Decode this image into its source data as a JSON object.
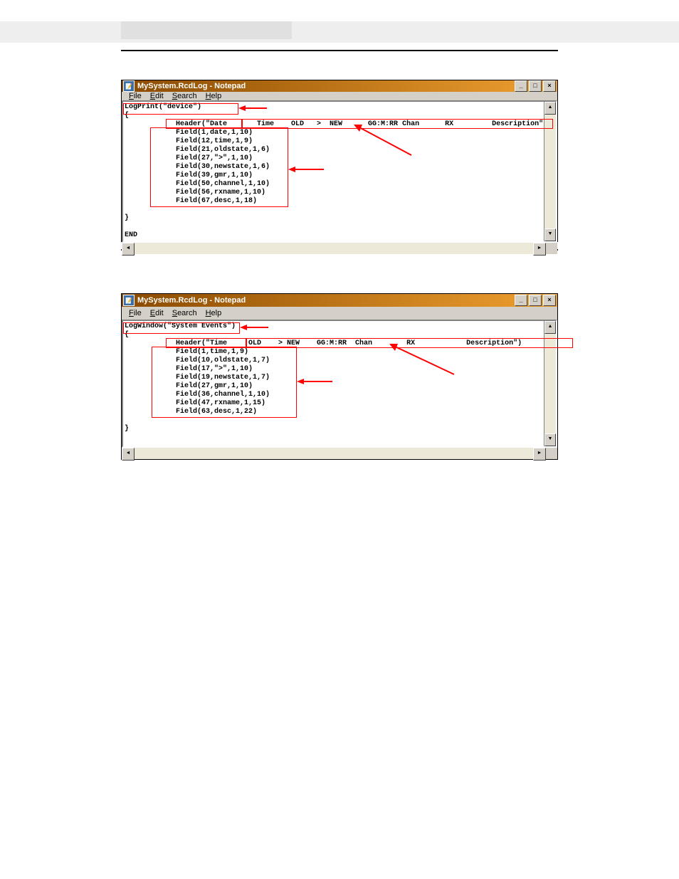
{
  "windows": [
    {
      "title": "MySystem.RcdLog - Notepad",
      "menus": [
        "File",
        "Edit",
        "Search",
        "Help"
      ],
      "lines": [
        "LogPrint(\"device\")",
        "{",
        "            Header(\"Date       Time    OLD   >  NEW      GG:M:RR Chan      RX         Description\")",
        "            Field(1,date,1,10)",
        "            Field(12,time,1,9)",
        "            Field(21,oldstate,1,6)",
        "            Field(27,\">\",1,10)",
        "            Field(30,newstate,1,6)",
        "            Field(39,gmr,1,10)",
        "            Field(50,channel,1,10)",
        "            Field(56,rxname,1,10)",
        "            Field(67,desc,1,18)",
        "",
        "}",
        "",
        "END"
      ]
    },
    {
      "title": "MySystem.RcdLog - Notepad",
      "menus": [
        "File",
        "Edit",
        "Search",
        "Help"
      ],
      "lines": [
        "LogWindow(\"System Events\")",
        "{",
        "            Header(\"Time     OLD    > NEW    GG:M:RR  Chan        RX            Description\")",
        "            Field(1,time,1,9)",
        "            Field(10,oldstate,1,7)",
        "            Field(17,\">\",1,10)",
        "            Field(19,newstate,1,7)",
        "            Field(27,gmr,1,10)",
        "            Field(36,channel,1,10)",
        "            Field(47,rxname,1,15)",
        "            Field(63,desc,1,22)",
        "",
        "}"
      ]
    }
  ],
  "control_labels": {
    "minimize": "_",
    "maximize": "□",
    "close": "×",
    "up": "▲",
    "down": "▼",
    "left": "◄",
    "right": "►"
  }
}
